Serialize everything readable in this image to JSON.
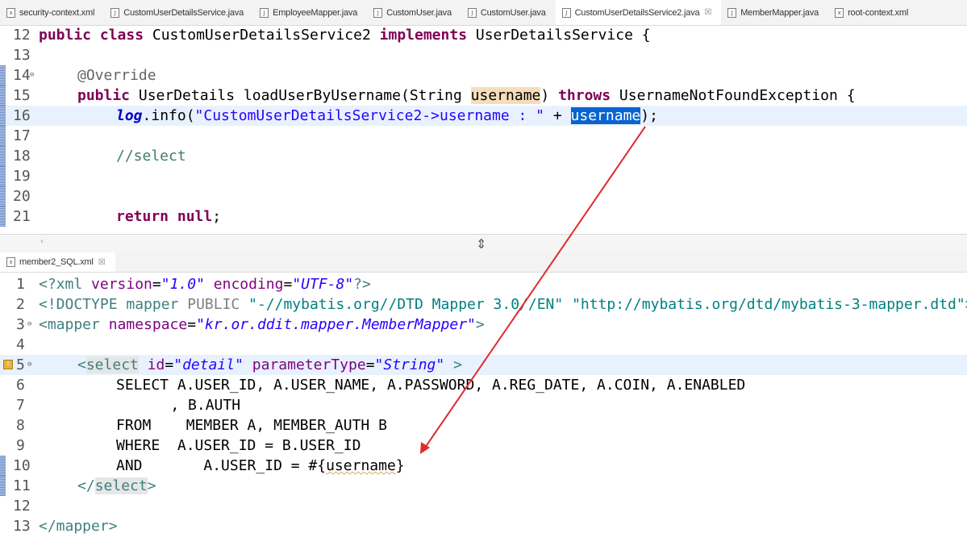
{
  "tabs": [
    {
      "label": "security-context.xml",
      "type": "xml"
    },
    {
      "label": "CustomUserDetailsService.java",
      "type": "java"
    },
    {
      "label": "EmployeeMapper.java",
      "type": "java"
    },
    {
      "label": "CustomUser.java",
      "type": "java"
    },
    {
      "label": "CustomUser.java",
      "type": "java"
    },
    {
      "label": "CustomUserDetailsService2.java",
      "type": "java",
      "active": true
    },
    {
      "label": "MemberMapper.java",
      "type": "java"
    },
    {
      "label": "root-context.xml",
      "type": "xml"
    }
  ],
  "java_editor": {
    "lines": [
      {
        "n": "12"
      },
      {
        "n": "13"
      },
      {
        "n": "14"
      },
      {
        "n": "15"
      },
      {
        "n": "16"
      },
      {
        "n": "17"
      },
      {
        "n": "18"
      },
      {
        "n": "19"
      },
      {
        "n": "20"
      },
      {
        "n": "21"
      }
    ],
    "t": {
      "l12_kw": "public class",
      "l12_name": " CustomUserDetailsService2 ",
      "l12_kw2": "implements",
      "l12_rest": " UserDetailsService {",
      "l14_ann": "@Override",
      "l15_kw": "public",
      "l15_a": " UserDetails loadUserByUsername(String ",
      "l15_param": "username",
      "l15_b": ") ",
      "l15_kw2": "throws",
      "l15_c": " UsernameNotFoundException {",
      "l16_log": "log",
      "l16_a": ".info(",
      "l16_str": "\"CustomUserDetailsService2->username : \"",
      "l16_b": " + ",
      "l16_sel": "username",
      "l16_c": ");",
      "l18_cmt": "//select",
      "l21_kw": "return",
      "l21_kw2": "null",
      "l21_c": ";"
    }
  },
  "xml_tab": {
    "label": "member2_SQL.xml"
  },
  "xml_editor": {
    "lines": [
      {
        "n": "1"
      },
      {
        "n": "2"
      },
      {
        "n": "3"
      },
      {
        "n": "4"
      },
      {
        "n": "5"
      },
      {
        "n": "6"
      },
      {
        "n": "7"
      },
      {
        "n": "8"
      },
      {
        "n": "9"
      },
      {
        "n": "10"
      },
      {
        "n": "11"
      },
      {
        "n": "12"
      },
      {
        "n": "13"
      }
    ],
    "t": {
      "x1_a": "<?xml ",
      "x1_attr1": "version",
      "x1_eq": "=",
      "x1_val1": "\"1.0\"",
      "x1_sp": " ",
      "x1_attr2": "encoding",
      "x1_eq2": "=",
      "x1_val2": "\"UTF-8\"",
      "x1_end": "?>",
      "x2_a": "<!DOCTYPE mapper ",
      "x2_pub": "PUBLIC",
      "x2_b": " \"-//mybatis.org//DTD Mapper 3.0//EN\" \"http://mybatis.org/dtd/mybatis-3-mapper.dtd\">",
      "x3_a": "<mapper ",
      "x3_attr": "namespace",
      "x3_eq": "=",
      "x3_val": "\"kr.or.ddit.mapper.MemberMapper\"",
      "x3_end": ">",
      "x5_lt": "<",
      "x5_tag": "select",
      "x5_sp": " ",
      "x5_attr1": "id",
      "x5_eq1": "=",
      "x5_val1": "\"detail\"",
      "x5_sp2": " ",
      "x5_attr2": "parameterType",
      "x5_eq2": "=",
      "x5_val2": "\"String\"",
      "x5_end": " >",
      "x6": "SELECT A.USER_ID, A.USER_NAME, A.PASSWORD, A.REG_DATE, A.COIN, A.ENABLED",
      "x7": "    , B.AUTH",
      "x8": "FROM    MEMBER A, MEMBER_AUTH B",
      "x9": "WHERE  A.USER_ID = B.USER_ID",
      "x10_a": "AND       A.USER_ID = #{",
      "x10_sq": "username",
      "x10_b": "}",
      "x11_a": "</",
      "x11_tag": "select",
      "x11_b": ">",
      "x13": "</mapper>"
    }
  }
}
